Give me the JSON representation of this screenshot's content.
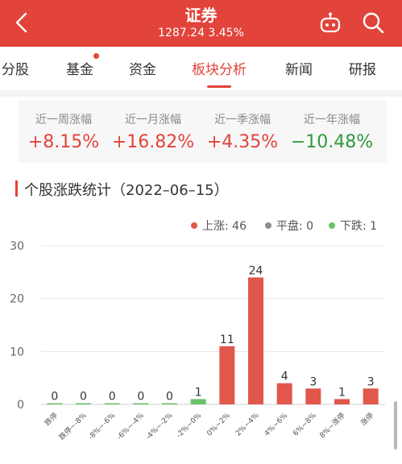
{
  "header": {
    "title": "证券",
    "subtitle": "1287.24 3.45%",
    "back_icon": "chevron-left-icon",
    "robot_icon": "robot-icon",
    "search_icon": "search-icon"
  },
  "tabs": [
    {
      "label": "分股",
      "active": false
    },
    {
      "label": "基金",
      "active": false,
      "has_dot": true
    },
    {
      "label": "资金",
      "active": false
    },
    {
      "label": "板块分析",
      "active": true
    },
    {
      "label": "新闻",
      "active": false
    },
    {
      "label": "研报",
      "active": false
    }
  ],
  "stats": [
    {
      "label": "近一周涨幅",
      "value": "+8.15%",
      "color": "#e2433a"
    },
    {
      "label": "近一月涨幅",
      "value": "+16.82%",
      "color": "#e2433a"
    },
    {
      "label": "近一季涨幅",
      "value": "+4.35%",
      "color": "#e2433a"
    },
    {
      "label": "近一年涨幅",
      "value": "−10.48%",
      "color": "#2e9a3c"
    }
  ],
  "section": {
    "title": "个股涨跌统计（2022–06–15）"
  },
  "legend": [
    {
      "label": "上涨: 46",
      "color": "#e2574c"
    },
    {
      "label": "平盘: 0",
      "color": "#8c8c8c"
    },
    {
      "label": "下跌: 1",
      "color": "#6cc26a"
    }
  ],
  "colors": {
    "accent": "#e2433a",
    "up": "#e2574c",
    "flat": "#8c8c8c",
    "down": "#6cc26a",
    "grid": "#e6e6e6"
  },
  "chart_data": {
    "type": "bar",
    "categories": [
      "跌停",
      "跌停~-8%",
      "-8%~-6%",
      "-6%~-4%",
      "-4%~-2%",
      "-2%~0%",
      "0%~2%",
      "2%~4%",
      "4%~6%",
      "6%~8%",
      "8%~涨停",
      "涨停"
    ],
    "values": [
      0,
      0,
      0,
      0,
      0,
      1,
      11,
      24,
      4,
      3,
      1,
      3
    ],
    "bar_colors": [
      "#6cc26a",
      "#6cc26a",
      "#6cc26a",
      "#6cc26a",
      "#6cc26a",
      "#6cc26a",
      "#e2574c",
      "#e2574c",
      "#e2574c",
      "#e2574c",
      "#e2574c",
      "#e2574c"
    ],
    "yticks": [
      0,
      10,
      20,
      30
    ],
    "ylim": [
      0,
      30
    ],
    "grid": true,
    "legend_position": "top-right"
  }
}
